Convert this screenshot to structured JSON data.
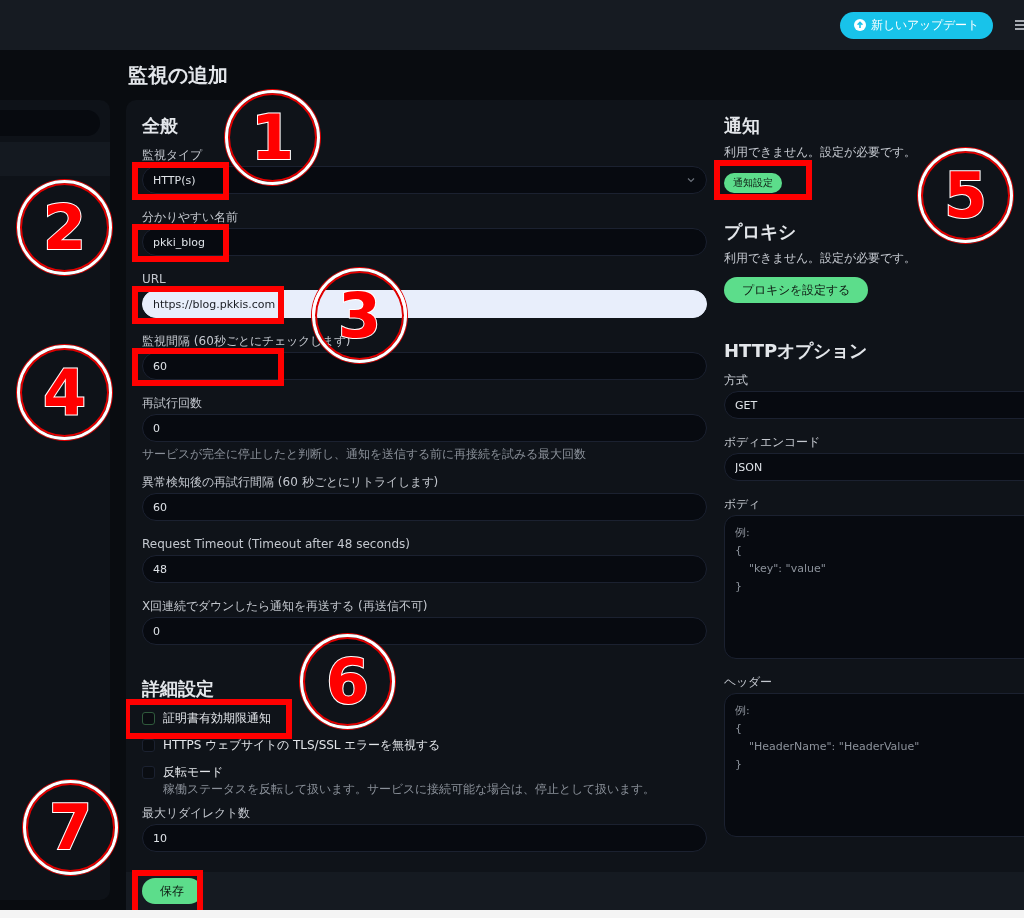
{
  "header": {
    "update_button": "新しいアップデート"
  },
  "page_title": "監視の追加",
  "general": {
    "title": "全般",
    "fields": [
      {
        "label": "監視タイプ",
        "kind": "select",
        "value": "HTTP(s)",
        "highlighted": true
      },
      {
        "label": "分かりやすい名前",
        "kind": "text",
        "value": "pkki_blog",
        "highlighted": true
      },
      {
        "label": "URL",
        "kind": "url",
        "value": "https://blog.pkkis.com",
        "highlighted": true
      },
      {
        "label": "監視間隔 (60秒ごとにチェックします)",
        "kind": "text",
        "value": "60",
        "highlighted": true
      },
      {
        "label": "再試行回数",
        "kind": "text",
        "value": "0",
        "highlighted": false,
        "hint": "サービスが完全に停止したと判断し、通知を送信する前に再接続を試みる最大回数"
      },
      {
        "label": "異常検知後の再試行間隔 (60 秒ごとにリトライします)",
        "kind": "text",
        "value": "60",
        "highlighted": false
      },
      {
        "label": "Request Timeout (Timeout after 48 seconds)",
        "kind": "text",
        "value": "48",
        "highlighted": false
      },
      {
        "label": "X回連続でダウンしたら通知を再送する (再送信不可)",
        "kind": "text",
        "value": "0",
        "highlighted": false
      }
    ]
  },
  "advanced": {
    "title": "詳細設定",
    "checkboxes": [
      {
        "label": "証明書有効期限通知",
        "checked": false,
        "focused": true,
        "highlighted": true
      },
      {
        "label": "HTTPS ウェブサイトの TLS/SSL エラーを無視する",
        "checked": false,
        "focused": false,
        "highlighted": false
      },
      {
        "label": "反転モード",
        "checked": false,
        "focused": false,
        "highlighted": false,
        "hint": "稼働ステータスを反転して扱います。サービスに接続可能な場合は、停止として扱います。"
      }
    ],
    "fields": [
      {
        "label": "最大リダイレクト数",
        "kind": "text",
        "value": "10",
        "highlighted": false
      }
    ]
  },
  "notifications": {
    "title": "通知",
    "text": "利用できません。設定が必要です。",
    "button": "通知設定",
    "highlighted": true
  },
  "proxy": {
    "title": "プロキシ",
    "text": "利用できません。設定が必要です。",
    "button": "プロキシを設定する",
    "highlighted": false
  },
  "http_options": {
    "title": "HTTPオプション",
    "fields": [
      {
        "label": "方式",
        "kind": "text",
        "value": "GET"
      },
      {
        "label": "ボディエンコード",
        "kind": "text",
        "value": "JSON"
      },
      {
        "label": "ボディ",
        "kind": "textarea",
        "placeholder": "例:\n{\n    \"key\": \"value\"\n}"
      },
      {
        "label": "ヘッダー",
        "kind": "textarea",
        "placeholder": "例:\n{\n    \"HeaderName\": \"HeaderValue\"\n}"
      }
    ]
  },
  "save_button": {
    "label": "保存",
    "highlighted": true
  },
  "callouts": [
    {
      "number": "1"
    },
    {
      "number": "2"
    },
    {
      "number": "3"
    },
    {
      "number": "4"
    },
    {
      "number": "5"
    },
    {
      "number": "6"
    },
    {
      "number": "7"
    }
  ]
}
